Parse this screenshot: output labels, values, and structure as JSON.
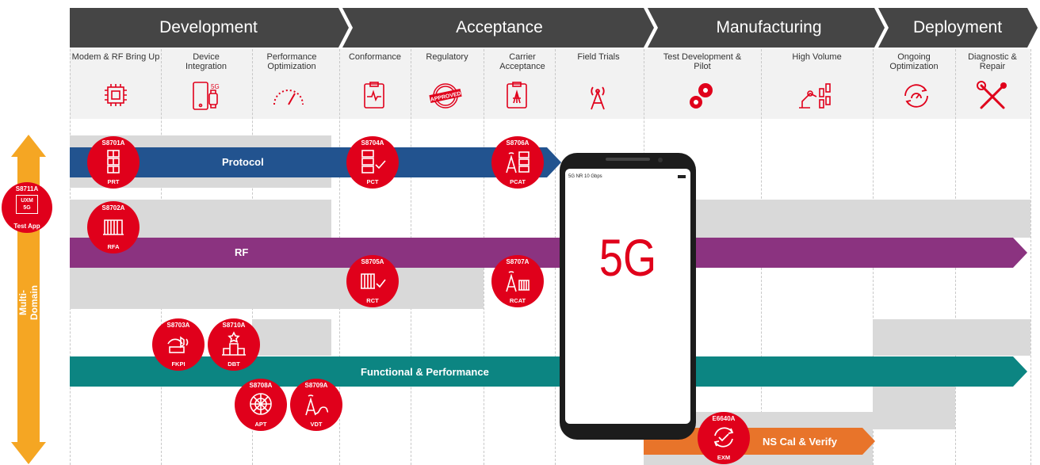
{
  "colors": {
    "phase_bar": "#454545",
    "protocol": "#22538f",
    "rf": "#8b3380",
    "functional": "#0c8582",
    "ns_cal": "#e8742a",
    "multi_domain": "#f5a623",
    "badge": "#e0001b",
    "shade": "#d9d9d9"
  },
  "phases": [
    "Development",
    "Acceptance",
    "Manufacturing",
    "Deployment"
  ],
  "subphases": [
    "Modem & RF Bring Up",
    "Device Integration",
    "Performance Optimization",
    "Conformance",
    "Regulatory",
    "Carrier Acceptance",
    "Field Trials",
    "Test Development & Pilot",
    "High Volume",
    "Ongoing Optimization",
    "Diagnostic & Repair"
  ],
  "subphase_icons": [
    "chip-icon",
    "phone-watch-icon",
    "gauge-icon",
    "clipboard-waveform-icon",
    "approved-stamp-icon",
    "clipboard-tower-icon",
    "cell-tower-icon",
    "gears-icon",
    "robot-arm-icon",
    "refresh-gauge-icon",
    "tools-icon"
  ],
  "multi_domain": {
    "label": "Multi-Domain",
    "badge": {
      "code": "S8711A",
      "line1": "UXM",
      "line2": "5G",
      "caption": "Test App"
    }
  },
  "lanes": {
    "protocol": "Protocol",
    "rf": "RF",
    "functional": "Functional & Performance",
    "ns_cal": "NS Cal & Verify"
  },
  "badges": [
    {
      "code": "S8701A",
      "abbr": "PRT"
    },
    {
      "code": "S8704A",
      "abbr": "PCT"
    },
    {
      "code": "S8706A",
      "abbr": "PCAT"
    },
    {
      "code": "S8702A",
      "abbr": "RFA"
    },
    {
      "code": "S8705A",
      "abbr": "RCT"
    },
    {
      "code": "S8707A",
      "abbr": "RCAT"
    },
    {
      "code": "S8703A",
      "abbr": "FKPI"
    },
    {
      "code": "S8710A",
      "abbr": "DBT"
    },
    {
      "code": "S8708A",
      "abbr": "APT"
    },
    {
      "code": "S8709A",
      "abbr": "VDT"
    },
    {
      "code": "E6640A",
      "abbr": "EXM"
    }
  ],
  "phone": {
    "status_left": "5G NR  10 Gbps",
    "big_text": "5G"
  }
}
